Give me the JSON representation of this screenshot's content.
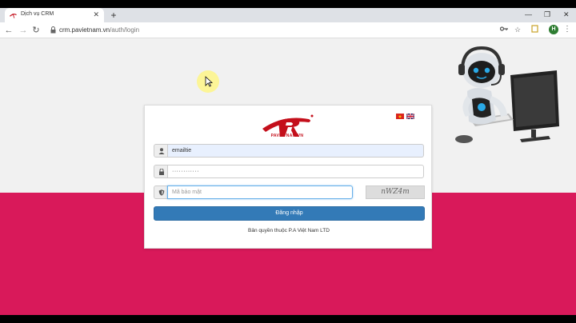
{
  "browser": {
    "tab": {
      "title": "Dịch vụ CRM",
      "close_icon": "close-icon"
    },
    "url": {
      "host": "crm.pavietnam.vn",
      "path": "/auth/login"
    },
    "profile_initial": "H",
    "icons": {
      "back": "back-arrow-icon",
      "forward": "forward-arrow-icon",
      "reload": "reload-icon",
      "lock": "lock-icon",
      "key": "key-icon",
      "bookmark": "star-icon",
      "extension": "extension-icon",
      "menu": "more-vertical-icon"
    }
  },
  "login": {
    "brand": "PAVIETNAM.VN",
    "languages": [
      "vi",
      "en"
    ],
    "username": {
      "value": "emailtie",
      "icon": "user-icon"
    },
    "password": {
      "value": "············",
      "icon": "lock-icon"
    },
    "captcha_input": {
      "placeholder": "Mã bảo mật",
      "icon": "shield-icon"
    },
    "captcha_image_text": "nWZ4m",
    "submit_label": "Đăng nhập",
    "copyright": "Bản quyền thuộc P.A Việt Nam LTD"
  },
  "colors": {
    "accent": "#d9195a",
    "button": "#337ab7",
    "brand_red": "#c40f1b",
    "background": "#f1f1f1"
  }
}
